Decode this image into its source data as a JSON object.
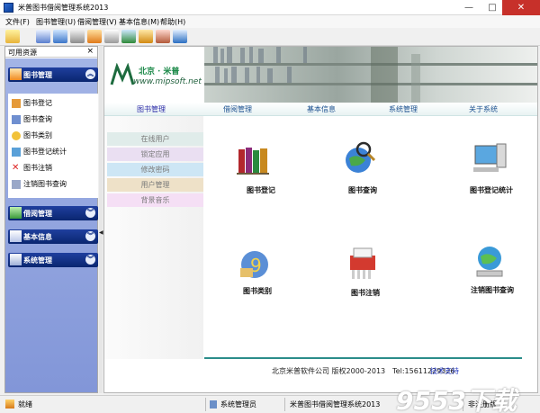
{
  "window": {
    "title": "米普图书借阅管理系统2013",
    "min": "—",
    "max": "□",
    "close": "✕"
  },
  "menu": [
    "文件(F)",
    "图书管理(U)",
    "借阅管理(V)",
    "基本信息(M)",
    "帮助(H)"
  ],
  "left_panel": {
    "title": "可用资源",
    "close": "×",
    "sections": [
      {
        "label": "图书管理",
        "chev": "︽"
      },
      {
        "label": "借阅管理",
        "chev": "︾"
      },
      {
        "label": "基本信息",
        "chev": "︾"
      },
      {
        "label": "系统管理",
        "chev": "︾"
      }
    ],
    "items": [
      "图书登记",
      "图书查询",
      "图书类别",
      "图书登记统计",
      "图书注销",
      "注销图书查询"
    ]
  },
  "banner": {
    "logo_cn": "北京 · 米普",
    "logo_url": "www.mipsoft.net"
  },
  "tabs": [
    "图书管理",
    "借阅管理",
    "基本信息",
    "系统管理",
    "关于系统"
  ],
  "options": [
    "在线用户",
    "锁定应用",
    "修改密码",
    "用户管理",
    "背景音乐"
  ],
  "modules": [
    "图书登记",
    "图书查询",
    "图书登记统计",
    "图书类别",
    "图书注销",
    "注销图书查询"
  ],
  "footer": {
    "text": "北京米普软件公司 版权2000-2013　Tel:15611229326",
    "link": "技术支持"
  },
  "status": {
    "ready": "就绪",
    "user": "系统管理员",
    "app": "米普图书借阅管理系统2013",
    "reg": "非注册版"
  },
  "watermark": "9553下载"
}
